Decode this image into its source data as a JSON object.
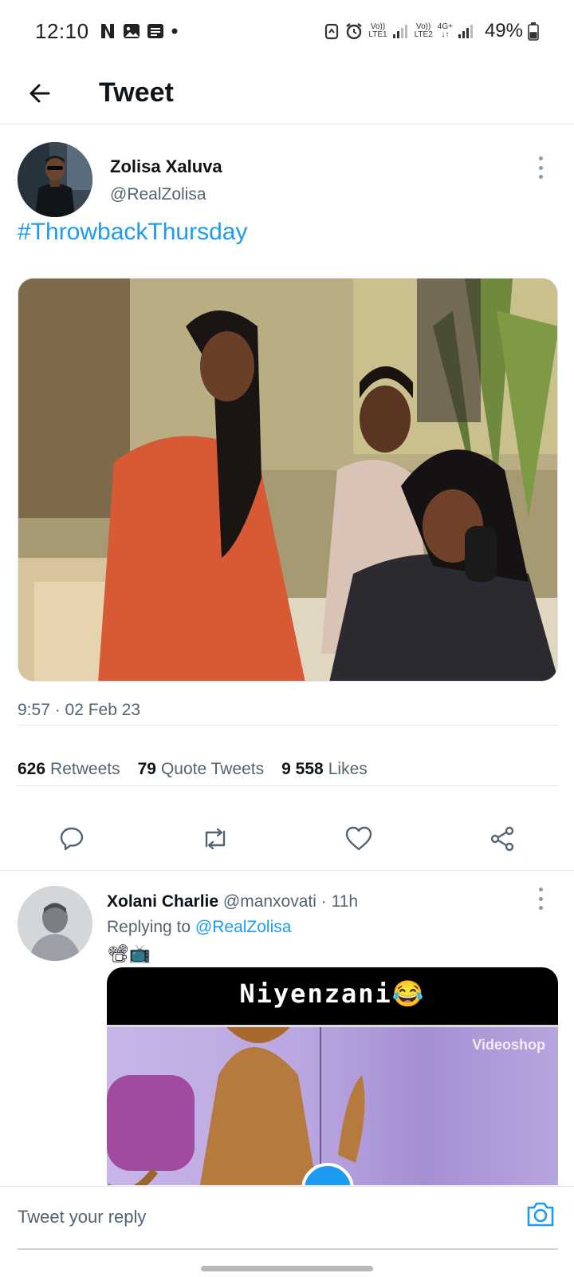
{
  "status_bar": {
    "time": "12:10",
    "net1_top": "Vo))",
    "net1_bottom": "LTE1",
    "net2_top": "Vo))",
    "net2_bottom": "LTE2",
    "net2_type_top": "4G+",
    "net2_type_bottom": "↓↑",
    "battery": "49%",
    "battery_level": 0.49
  },
  "header": {
    "title": "Tweet"
  },
  "tweet": {
    "author_name": "Zolisa Xaluva",
    "author_handle": "@RealZolisa",
    "text": "#ThrowbackThursday",
    "timestamp": "9:57 · 02 Feb 23",
    "stats": {
      "retweets_count": "626",
      "retweets_label": "Retweets",
      "quotes_count": "79",
      "quotes_label": "Quote Tweets",
      "likes_count": "9 558",
      "likes_label": "Likes"
    }
  },
  "reply": {
    "author_name": "Xolani Charlie",
    "author_handle": "@manxovati",
    "time": "· 11h",
    "replying_prefix": "Replying to",
    "replying_handle": "@RealZolisa",
    "emoji": "📽📺",
    "video_caption": "Niyenzani😂",
    "video_watermark": "Videoshop"
  },
  "compose": {
    "placeholder": "Tweet your reply"
  },
  "colors": {
    "accent": "#1d9bf0",
    "secondary_text": "#536471",
    "divider": "#e1e6ea"
  }
}
